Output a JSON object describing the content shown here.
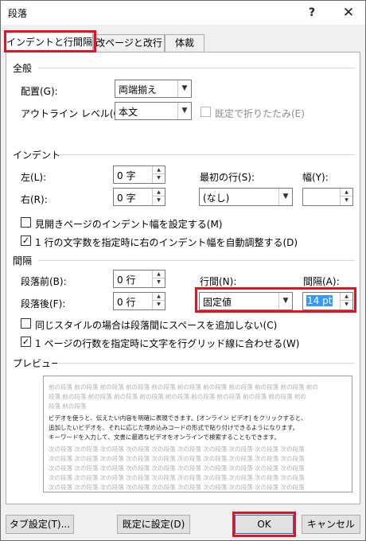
{
  "title": "段落",
  "help": "?",
  "close": "✕",
  "tabs": [
    "インデントと行間隔",
    "改ページと改行",
    "体裁"
  ],
  "general": {
    "title": "全般",
    "alignment_label": "配置(G):",
    "alignment_value": "両端揃え",
    "outline_label": "アウトライン レベル(O):",
    "outline_value": "本文",
    "collapsed_label": "既定で折りたたみ(E)"
  },
  "indent": {
    "title": "インデント",
    "left_label": "左(L):",
    "left_value": "0 字",
    "right_label": "右(R):",
    "right_value": "0 字",
    "first_line_label": "最初の行(S):",
    "first_line_value": "(なし)",
    "width_label": "幅(Y):",
    "width_value": "",
    "mirror_label": "見開きページのインデント幅を設定する(M)",
    "auto_adjust_label": "1 行の文字数を指定時に右のインデント幅を自動調整する(D)"
  },
  "spacing": {
    "title": "間隔",
    "before_label": "段落前(B):",
    "before_value": "0 行",
    "after_label": "段落後(F):",
    "after_value": "0 行",
    "line_spacing_label": "行間(N):",
    "line_spacing_value": "固定値",
    "at_label": "間隔(A):",
    "at_value": "14 pt",
    "no_space_label": "同じスタイルの場合は段落間にスペースを追加しない(C)",
    "grid_label": "1 ページの行数を指定時に文字を行グリッド線に合わせる(W)"
  },
  "preview": {
    "title": "プレビュー",
    "prev_lines": [
      "前の段落 前の段落 前の段落 前の段落 前の段落 前の段落 前の段落 前の段落 前の段落 前の段落 前の",
      "段落 前の段落 前の段落 前の段落 前の段落 前の段落 前の段落 前の段落 前の段落 前の段落 前の",
      "段落 前の段落"
    ],
    "body_lines": [
      "ビデオを使うと、伝えたい内容を明確に表現できます。[オンライン ビデオ] をクリックすると、",
      "追加したいビデオを、それに応じた埋め込みコードの形式で貼り付けできるようになります。",
      "キーワードを入力して、文書に最適なビデオをオンラインで検索することもできます。"
    ],
    "next_lines": [
      "次の段落 次の段落 次の段落 次の段落 次の段落 次の段落 次の段落 次の段落 次の段落 次の段落",
      "次の段落 次の段落 次の段落 次の段落 次の段落 次の段落 次の段落 次の段落 次の段落 次の段落",
      "次の段落 次の段落 次の段落 次の段落 次の段落 次の段落 次の段落 次の段落 次の段落 次の段落",
      "次の段落 次の段落 次の段落 次の段落 次の段落 次の段落 次の段落 次の段落 次の段落 次の段落",
      "次の段落 次の段落 次の段落 次の段落 次の段落 次の段落 次の段落 次の段落 次の段落 次の段落"
    ]
  },
  "buttons": {
    "tabs": "タブ設定(T)...",
    "default": "既定に設定(D)",
    "ok": "OK",
    "cancel": "キャンセル"
  },
  "colors": {
    "highlight": "#e8121e",
    "selection": "#3399ff"
  }
}
